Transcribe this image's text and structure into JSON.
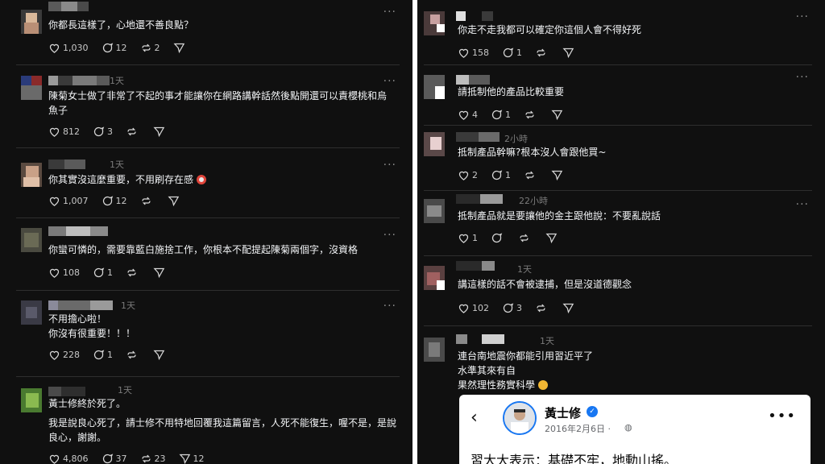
{
  "left_comments": [
    {
      "time": "",
      "lines": [
        "你都長這樣了，心地還不善良點？"
      ],
      "likes": "1,030",
      "replies": "12",
      "reposts": "2"
    },
    {
      "time": "1天",
      "lines": [
        "陳菊女士做了非常了不起的事才能讓你在網路講幹話然後點開還可以責櫻桃和烏",
        "魚子"
      ],
      "likes": "812",
      "replies": "3",
      "reposts": ""
    },
    {
      "time": "1天",
      "lines": [
        "你其實沒這麼重要，不用刷存在感"
      ],
      "likes": "1,007",
      "replies": "12",
      "reposts": ""
    },
    {
      "time": "",
      "lines": [
        "你蠻可憐的，需要靠藍白施捨工作，你根本不配提起陳菊兩個字，沒資格"
      ],
      "likes": "108",
      "replies": "1",
      "reposts": ""
    },
    {
      "time": "1天",
      "lines": [
        "不用擔心啦！",
        "你沒有很重要！！！"
      ],
      "likes": "228",
      "replies": "1",
      "reposts": ""
    },
    {
      "time": "1天",
      "lines": [
        "黃士修終於死了。",
        "",
        "我是說良心死了，請士修不用特地回覆我這篇留言，人死不能復生，喔不是，是說",
        "良心，謝謝。"
      ],
      "likes": "4,806",
      "replies": "37",
      "reposts": "23",
      "shares": "12"
    }
  ],
  "right_comments": [
    {
      "time": "",
      "lines": [
        "你走不走我都可以確定你這個人會不得好死"
      ],
      "likes": "158",
      "replies": "1",
      "reposts": ""
    },
    {
      "time": "",
      "lines": [
        "請抵制他的產品比較重要"
      ],
      "likes": "4",
      "replies": "1",
      "reposts": ""
    },
    {
      "time": "2小時",
      "lines": [
        "抵制產品幹嘛?根本沒人會跟他買~"
      ],
      "likes": "2",
      "replies": "1",
      "reposts": ""
    },
    {
      "time": "22小時",
      "lines": [
        "抵制產品就是要讓他的金主跟他說：不要亂說話"
      ],
      "likes": "1",
      "replies": "",
      "reposts": ""
    },
    {
      "time": "1天",
      "lines": [
        "講這樣的話不會被逮捕，但是沒道德觀念"
      ],
      "likes": "102",
      "replies": "3",
      "reposts": ""
    },
    {
      "time": "1天",
      "lines": [
        "連台南地震你都能引用習近平了",
        "水準其來有自",
        "果然理性務實科學"
      ],
      "likes": "",
      "replies": "",
      "reposts": ""
    }
  ],
  "fb_card": {
    "name": "黃士修",
    "date": "2016年2月6日 ·",
    "body": "習大大表示：基礎不牢，地動山搖。"
  },
  "icons": {
    "like": "heart-icon",
    "reply": "comment-icon",
    "repost": "repost-icon",
    "share": "send-icon",
    "more": "more-icon"
  },
  "colors": {
    "background": "#101010",
    "text": "#f3f5f7",
    "muted": "#7a7a7a",
    "fb_blue": "#1877f2"
  }
}
